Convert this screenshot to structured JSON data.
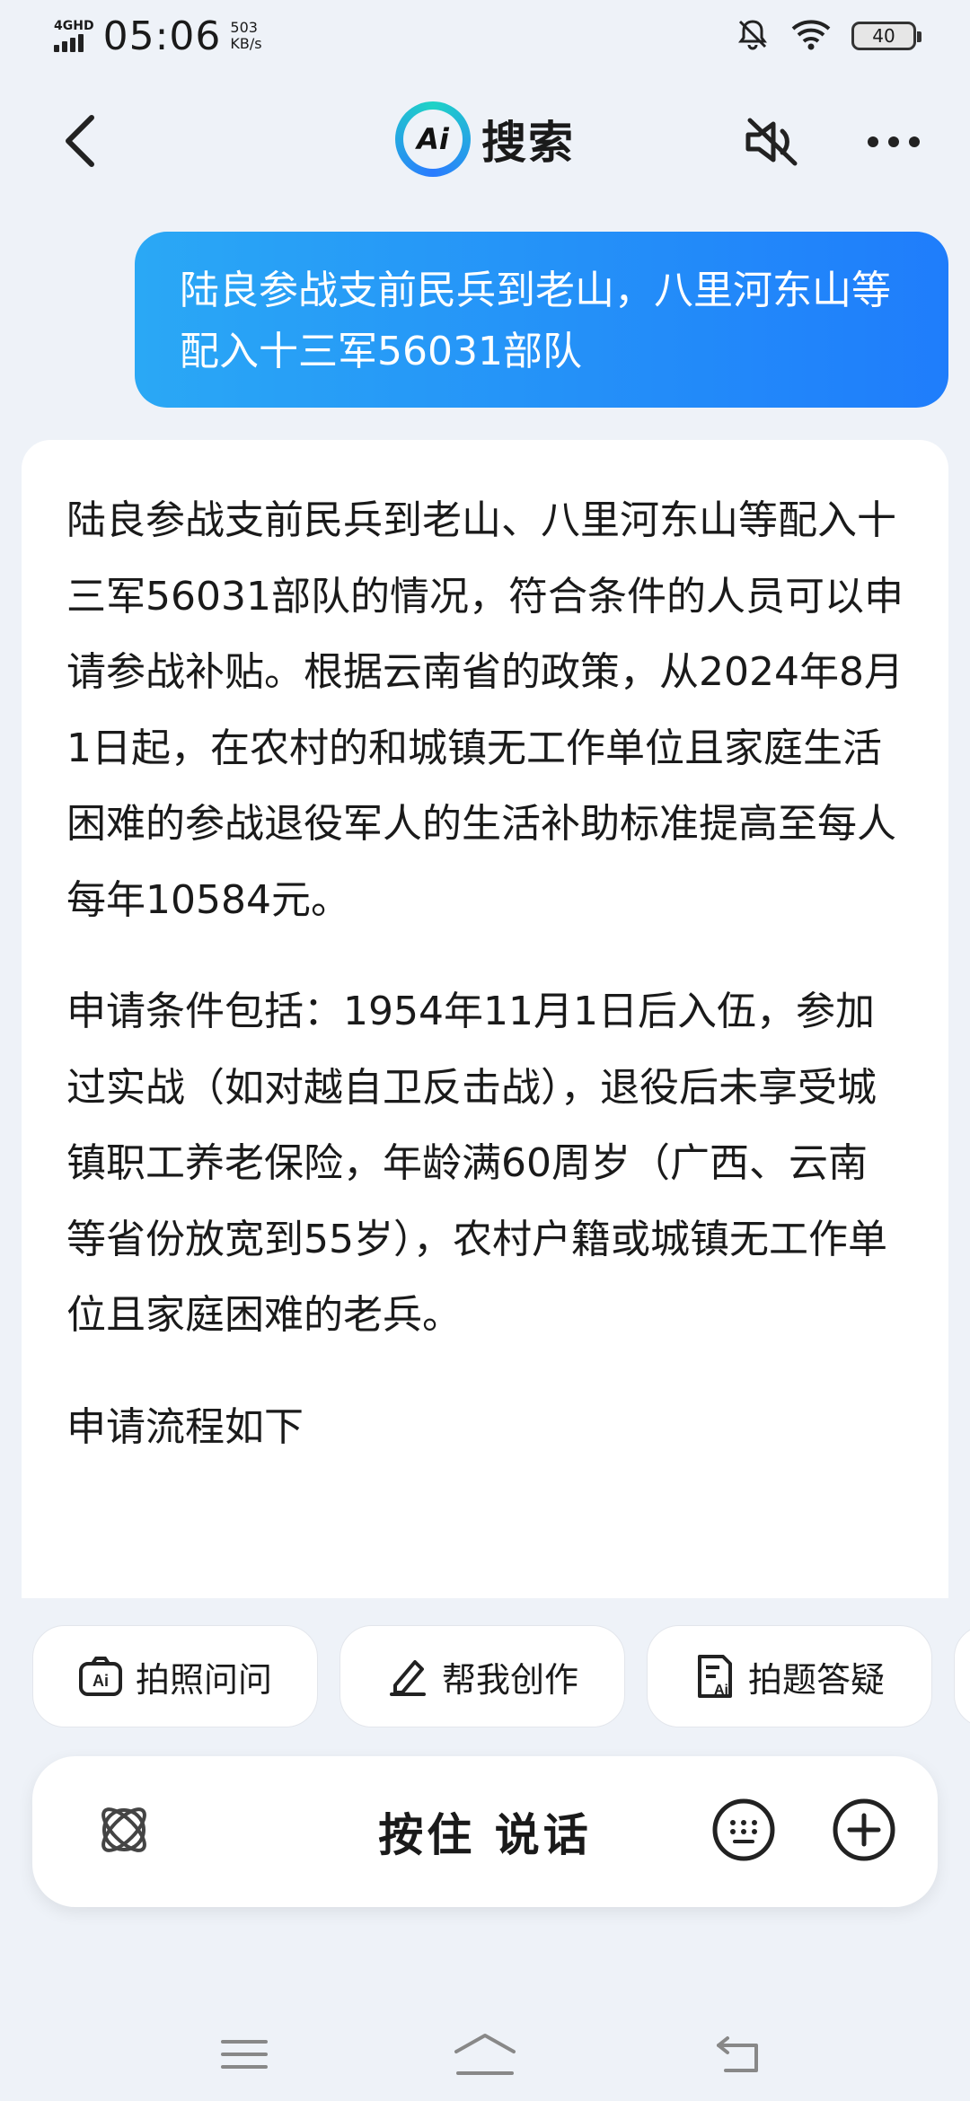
{
  "status_bar": {
    "network": "4GHD",
    "time": "05:06",
    "speed_value": "503",
    "speed_unit": "KB/s",
    "battery": "40"
  },
  "header": {
    "logo_text": "Ai",
    "title": "搜索"
  },
  "user_message": "陆良参战支前民兵到老山，八里河东山等配入十三军56031部队",
  "answer": {
    "paragraphs": [
      "陆良参战支前民兵到老山、八里河东山等配入十三军56031部队的情况，符合条件的人员可以申请参战补贴。根据云南省的政策，从2024年8月1日起，在农村的和城镇无工作单位且家庭生活困难的参战退役军人的生活补助标准提高至每人每年10584元。",
      "申请条件包括：1954年11月1日后入伍，参加过实战（如对越自卫反击战），退役后未享受城镇职工养老保险，年龄满60周岁（广西、云南等省份放宽到55岁），农村户籍或城镇无工作单位且家庭困难的老兵。",
      "申请流程如下"
    ]
  },
  "chips": [
    {
      "label": "拍照问问",
      "icon": "camera-ai-icon"
    },
    {
      "label": "帮我创作",
      "icon": "pen-icon"
    },
    {
      "label": "拍题答疑",
      "icon": "document-ai-icon"
    }
  ],
  "input_bar": {
    "hold_to_talk": "按住 说话"
  }
}
